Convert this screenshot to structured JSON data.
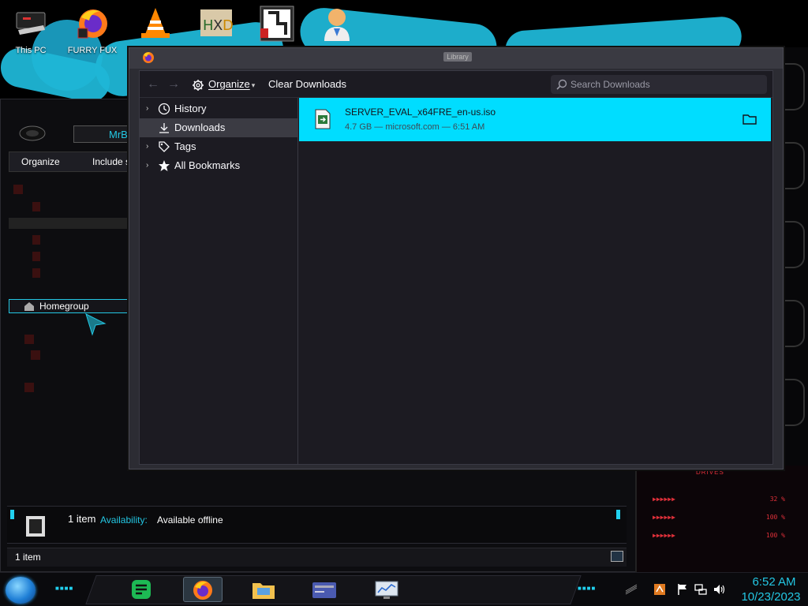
{
  "desktop": {
    "icons": [
      {
        "label": "This PC",
        "icon": "computer-icon"
      },
      {
        "label": "FURRY FUX",
        "icon": "firefox-icon"
      },
      {
        "label": "",
        "icon": "vlc-icon"
      },
      {
        "label": "",
        "icon": "hxd-icon"
      },
      {
        "label": "",
        "icon": "app-tile-icon"
      },
      {
        "label": "",
        "icon": "doctor-avatar-icon"
      }
    ]
  },
  "explorer": {
    "address_text": "MrB",
    "toolbar": {
      "organize": "Organize",
      "include": "Include s"
    },
    "homegroup": "Homegroup",
    "details": {
      "count": "1 item",
      "availability_label": "Availability:",
      "availability_value": "Available offline"
    },
    "status": "1 item"
  },
  "library": {
    "window_title": "Library",
    "toolbar": {
      "back_icon": "arrow-left-icon",
      "forward_icon": "arrow-right-icon",
      "organize": "Organize",
      "clear_downloads": "Clear Downloads",
      "search_placeholder": "Search Downloads"
    },
    "sidebar": [
      {
        "label": "History",
        "icon": "clock-icon",
        "expandable": true,
        "selected": false
      },
      {
        "label": "Downloads",
        "icon": "download-icon",
        "expandable": false,
        "selected": true
      },
      {
        "label": "Tags",
        "icon": "tag-icon",
        "expandable": true,
        "selected": false
      },
      {
        "label": "All Bookmarks",
        "icon": "star-icon",
        "expandable": true,
        "selected": false
      }
    ],
    "downloads": [
      {
        "filename": "SERVER_EVAL_x64FRE_en-us.iso",
        "meta": "4.7 GB — microsoft.com — 6:51 AM"
      }
    ]
  },
  "hud": {
    "title": "DRIVES",
    "rows": [
      "32 %",
      "100 %",
      "100 %"
    ]
  },
  "taskbar": {
    "apps": [
      "notes-icon",
      "firefox-icon",
      "file-explorer-icon",
      "card-icon",
      "monitor-icon"
    ],
    "clock_time": "6:52 AM",
    "clock_date": "10/23/2023"
  },
  "colors": {
    "accent": "#00ddff",
    "hud_red": "#e0303a",
    "clock": "#23c7e3"
  }
}
